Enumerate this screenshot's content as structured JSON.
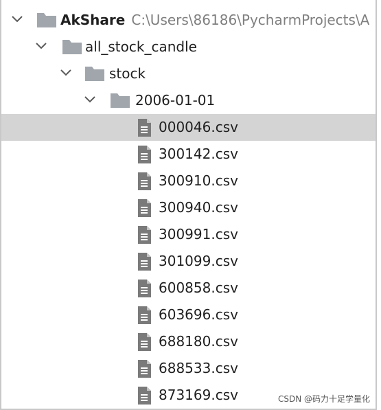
{
  "tree": {
    "root": {
      "name": "AkShare",
      "path": "C:\\Users\\86186\\PycharmProjects\\A"
    },
    "level1": {
      "name": "all_stock_candle"
    },
    "level2": {
      "name": "stock"
    },
    "level3": {
      "name": "2006-01-01"
    },
    "files": [
      {
        "name": "000046.csv",
        "selected": true
      },
      {
        "name": "300142.csv"
      },
      {
        "name": "300910.csv"
      },
      {
        "name": "300940.csv"
      },
      {
        "name": "300991.csv"
      },
      {
        "name": "301099.csv"
      },
      {
        "name": "600858.csv"
      },
      {
        "name": "603696.csv"
      },
      {
        "name": "688180.csv"
      },
      {
        "name": "688533.csv"
      },
      {
        "name": "873169.csv"
      }
    ]
  },
  "watermark": "CSDN @码力十足学量化",
  "colors": {
    "selection": "#d4d4d4",
    "folder": "#a0a6ac",
    "file": "#7a7a7a",
    "path_text": "#7f7f7f"
  },
  "icons": {
    "expanded": "chevron-down-icon",
    "folder": "folder-icon",
    "file": "file-icon"
  }
}
